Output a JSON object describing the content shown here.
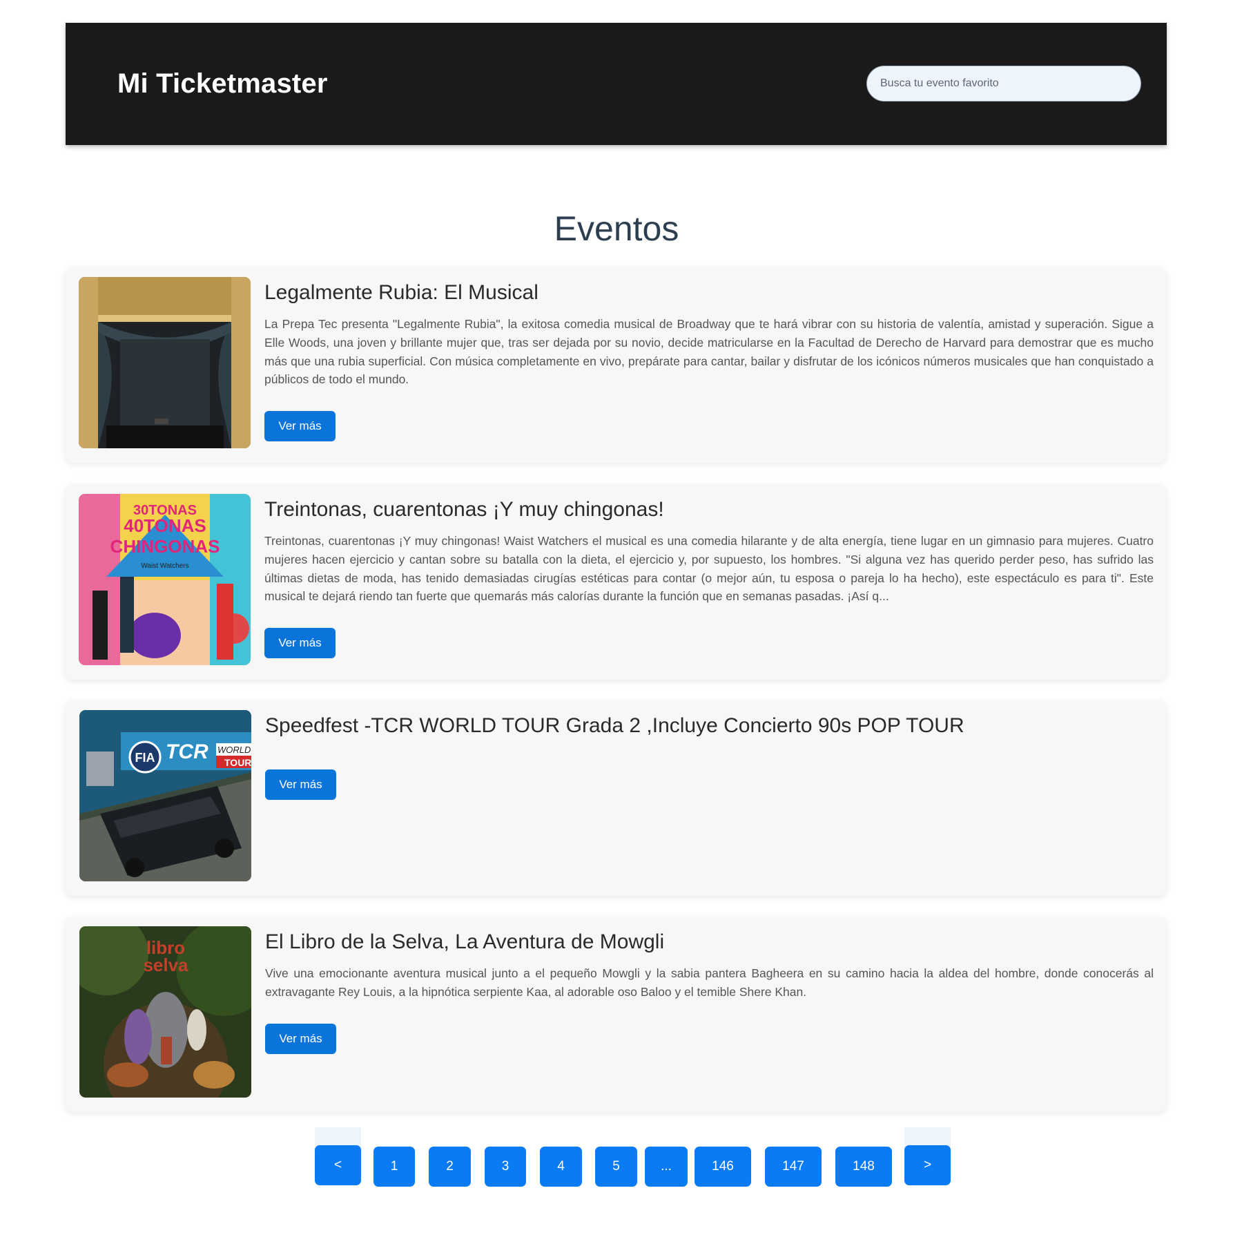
{
  "header": {
    "brand": "Mi Ticketmaster",
    "search_placeholder": "Busca tu evento favorito"
  },
  "page_title": "Eventos",
  "events": [
    {
      "title": "Legalmente Rubia: El Musical",
      "description": "La Prepa Tec presenta \"Legalmente Rubia\", la exitosa comedia musical de Broadway que te hará vibrar con su historia de valentía, amistad y superación. Sigue a Elle Woods, una joven y brillante mujer que, tras ser dejada por su novio, decide matricularse en la Facultad de Derecho de Harvard para demostrar que es mucho más que una rubia superficial. Con música completamente en vivo, prepárate para cantar, bailar y disfrutar de los icónicos números musicales que han conquistado a públicos de todo el mundo.",
      "button": "Ver más"
    },
    {
      "title": "Treintonas, cuarentonas ¡Y muy chingonas!",
      "description": "Treintonas, cuarentonas ¡Y muy chingonas! Waist Watchers el musical es una comedia hilarante y de alta energía, tiene lugar en un gimnasio para mujeres. Cuatro mujeres hacen ejercicio y cantan sobre su batalla con la dieta, el ejercicio y, por supuesto, los hombres. \"Si alguna vez has querido perder peso, has sufrido las últimas dietas de moda, has tenido demasiadas cirugías estéticas para contar (o mejor aún, tu esposa o pareja lo ha hecho), este espectáculo es para ti\". Este musical te dejará riendo tan fuerte que quemarás más calorías durante la función que en semanas pasadas. ¡Así q...",
      "button": "Ver más"
    },
    {
      "title": "Speedfest -TCR WORLD TOUR Grada 2 ,Incluye Concierto 90s POP TOUR",
      "description": "",
      "button": "Ver más"
    },
    {
      "title": "El Libro de la Selva, La Aventura de Mowgli",
      "description": "Vive una emocionante aventura musical junto a el pequeño Mowgli y la sabia pantera Bagheera en su camino hacia la aldea del hombre, donde conocerás al extravagante Rey Louis, a la hipnótica serpiente Kaa, al adorable oso Baloo y el temible Shere Khan.",
      "button": "Ver más"
    }
  ],
  "thumbnails": {
    "t2_line1": "30TONAS",
    "t2_line2": "40TONAS",
    "t2_line3": "CHINGONAS",
    "t2_line4": "Waist Watchers",
    "t3_fia": "FIA",
    "t3_tcr": "TCR",
    "t3_world": "WORLD",
    "t3_tour": "TOUR",
    "t4_line1": "libro",
    "t4_line2": "selva"
  },
  "pagination": {
    "prev": "<",
    "next": ">",
    "pages": [
      "1",
      "2",
      "3",
      "4",
      "5",
      "...",
      "146",
      "147",
      "148"
    ]
  }
}
